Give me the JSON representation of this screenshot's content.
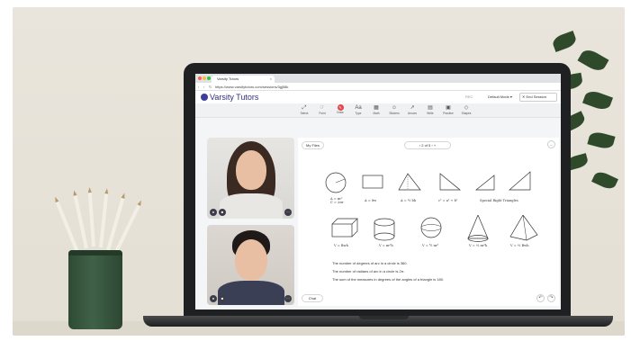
{
  "browser": {
    "tab_title": "Varsity Tutors",
    "tab_close": "×",
    "url": "https://www.varsitytutors.com/sessions/3gj58k",
    "back": "‹",
    "forward": "›",
    "reload": "↻"
  },
  "app": {
    "brand": "Varsity Tutors",
    "record_label": "REC",
    "mode_label": "Default Mode ▾",
    "end_session_label": "✕  End Session"
  },
  "toolbar": {
    "tools": [
      {
        "label": "Select",
        "icon": "⤢"
      },
      {
        "label": "Point",
        "icon": "☞"
      },
      {
        "label": "Draw",
        "icon": "✎"
      },
      {
        "label": "Type",
        "icon": "Aa"
      },
      {
        "label": "Math",
        "icon": "▦"
      },
      {
        "label": "Stickers",
        "icon": "☺"
      },
      {
        "label": "Arrows",
        "icon": "↗"
      },
      {
        "label": "Write",
        "icon": "▤"
      },
      {
        "label": "Practice",
        "icon": "▣"
      },
      {
        "label": "Shapes",
        "icon": "◇"
      }
    ]
  },
  "board": {
    "my_files": "My Files",
    "pager": "‹   2 of 5   ›   +",
    "more": "…",
    "chat": "Chat",
    "formulas_row1": [
      "A = πr²\nC = 2πr",
      "A = 8w",
      "A = ½ bh",
      "c² = a² + b²",
      "Special Right Triangles"
    ],
    "formulas_row2": [
      "V = Bwh",
      "V = πr²h",
      "V = ⁴⁄₃ πr³",
      "V = ⅓ πr²h",
      "V = ⅓ Bwh"
    ],
    "lines": [
      "The number of degrees of arc in a circle is 360.",
      "The number of radians of arc in a circle is 2π.",
      "The sum of the measures in degrees of the angles of a triangle is 180."
    ],
    "undo": "↶",
    "redo": "↷"
  },
  "colors": {
    "brand": "#2e2f7d",
    "active_tool": "#e2474b"
  }
}
